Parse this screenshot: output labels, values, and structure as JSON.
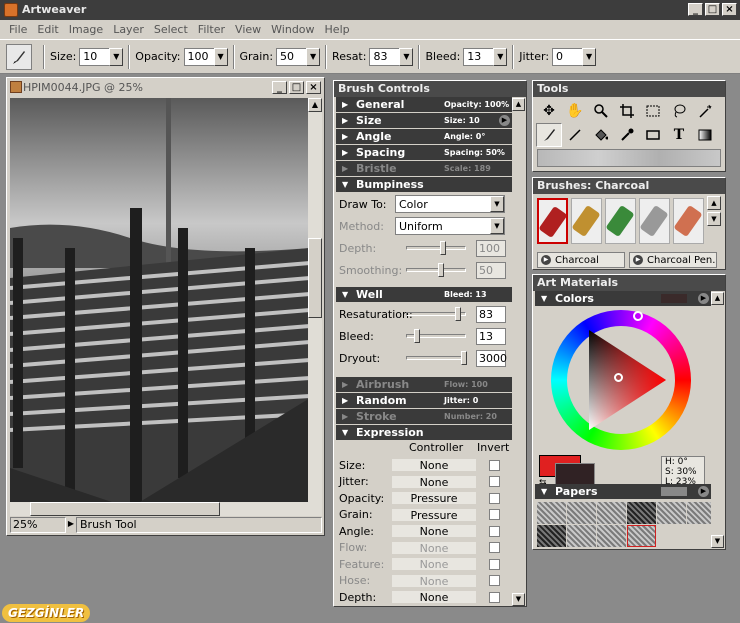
{
  "app": {
    "title": "Artweaver"
  },
  "window_controls": {
    "minimize": "_",
    "maximize": "□",
    "close": "×"
  },
  "menu": [
    "File",
    "Edit",
    "Image",
    "Layer",
    "Select",
    "Filter",
    "View",
    "Window",
    "Help"
  ],
  "toolbar": {
    "fields": [
      {
        "label": "Size:",
        "value": "10"
      },
      {
        "label": "Opacity:",
        "value": "100"
      },
      {
        "label": "Grain:",
        "value": "50"
      },
      {
        "label": "Resat:",
        "value": "83"
      },
      {
        "label": "Bleed:",
        "value": "13"
      },
      {
        "label": "Jitter:",
        "value": "0"
      }
    ]
  },
  "document": {
    "title": "HPIM0044.JPG @ 25%",
    "zoom": "25%",
    "tool": "Brush Tool"
  },
  "brush_controls": {
    "title": "Brush Controls",
    "sections": [
      {
        "label": "General",
        "info": "Opacity: 100%",
        "dim": false
      },
      {
        "label": "Size",
        "info": "Size: 10",
        "dim": false
      },
      {
        "label": "Angle",
        "info": "Angle: 0°",
        "dim": false
      },
      {
        "label": "Spacing",
        "info": "Spacing: 50%",
        "dim": false
      },
      {
        "label": "Bristle",
        "info": "Scale: 189",
        "dim": true
      }
    ],
    "bumpiness": {
      "label": "Bumpiness",
      "draw_to_label": "Draw To:",
      "draw_to_value": "Color",
      "method_label": "Method:",
      "method_value": "Uniform",
      "depth_label": "Depth:",
      "depth_value": "100",
      "smoothing_label": "Smoothing:",
      "smoothing_value": "50"
    },
    "well": {
      "label": "Well",
      "info": "Bleed: 13",
      "resaturation_label": "Resaturation:",
      "resaturation_value": "83",
      "bleed_label": "Bleed:",
      "bleed_value": "13",
      "dryout_label": "Dryout:",
      "dryout_value": "3000"
    },
    "more_sections": [
      {
        "label": "Airbrush",
        "info": "Flow: 100",
        "dim": true
      },
      {
        "label": "Random",
        "info": "Jitter: 0",
        "dim": false
      },
      {
        "label": "Stroke",
        "info": "Number: 20",
        "dim": true
      }
    ],
    "expression": {
      "label": "Expression",
      "col_controller": "Controller",
      "col_invert": "Invert",
      "rows": [
        {
          "label": "Size:",
          "controller": "None",
          "dim": false
        },
        {
          "label": "Jitter:",
          "controller": "None",
          "dim": false
        },
        {
          "label": "Opacity:",
          "controller": "Pressure",
          "dim": false
        },
        {
          "label": "Grain:",
          "controller": "Pressure",
          "dim": false
        },
        {
          "label": "Angle:",
          "controller": "None",
          "dim": false
        },
        {
          "label": "Flow:",
          "controller": "None",
          "dim": true
        },
        {
          "label": "Feature:",
          "controller": "None",
          "dim": true
        },
        {
          "label": "Hose:",
          "controller": "None",
          "dim": true
        },
        {
          "label": "Depth:",
          "controller": "None",
          "dim": false
        }
      ]
    }
  },
  "tools": {
    "title": "Tools"
  },
  "brushes": {
    "title": "Brushes: Charcoal",
    "category": "Charcoal",
    "variant": "Charcoal Pen..."
  },
  "art_materials": {
    "title": "Art Materials",
    "colors_label": "Colors",
    "h": "H: 0°",
    "s": "S: 30%",
    "l": "L: 23%",
    "primary_color": "#e02020",
    "secondary_color": "#302224",
    "papers_label": "Papers"
  },
  "watermark": "GEZGİNLER"
}
